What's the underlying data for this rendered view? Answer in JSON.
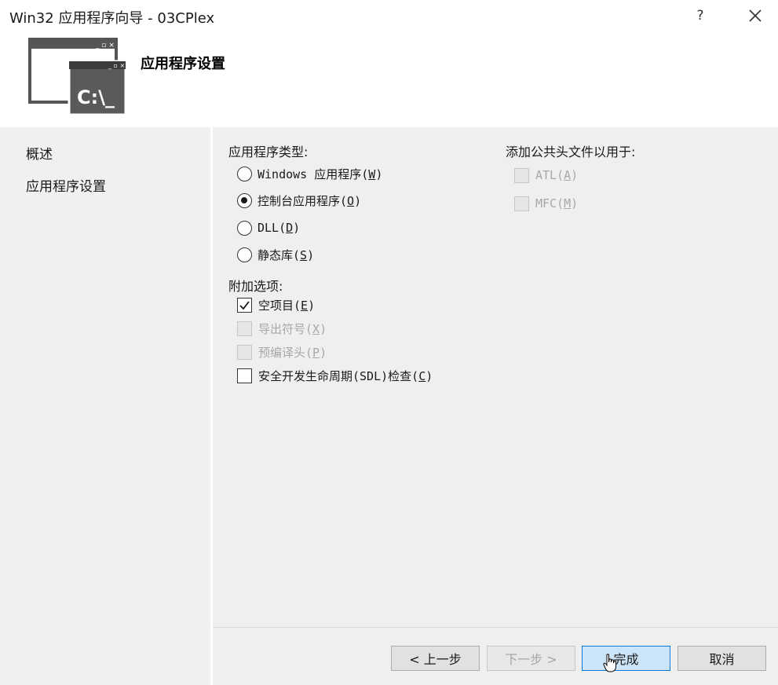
{
  "window": {
    "title": "Win32 应用程序向导 - 03CPlex",
    "help_label": "?"
  },
  "header": {
    "title": "应用程序设置",
    "icon": "console-window-icon",
    "icon_text": "C:\\_"
  },
  "nav": {
    "items": [
      {
        "label": "概述"
      },
      {
        "label": "应用程序设置"
      }
    ]
  },
  "app_type": {
    "label": "应用程序类型:",
    "options": [
      {
        "text": "Windows 应用程序",
        "mnemonic": "W",
        "selected": false
      },
      {
        "text": "控制台应用程序",
        "mnemonic": "O",
        "selected": true
      },
      {
        "text": "DLL",
        "mnemonic": "D",
        "selected": false
      },
      {
        "text": "静态库",
        "mnemonic": "S",
        "selected": false
      }
    ]
  },
  "additional": {
    "label": "附加选项:",
    "options": [
      {
        "text": "空项目",
        "mnemonic": "E",
        "checked": true,
        "enabled": true
      },
      {
        "text": "导出符号",
        "mnemonic": "X",
        "checked": false,
        "enabled": false
      },
      {
        "text": "预编译头",
        "mnemonic": "P",
        "checked": false,
        "enabled": false
      },
      {
        "text": "安全开发生命周期(SDL)检查",
        "mnemonic": "C",
        "checked": false,
        "enabled": true
      }
    ]
  },
  "headers": {
    "label": "添加公共头文件以用于:",
    "options": [
      {
        "text": "ATL",
        "mnemonic": "A",
        "checked": false,
        "enabled": false
      },
      {
        "text": "MFC",
        "mnemonic": "M",
        "checked": false,
        "enabled": false
      }
    ]
  },
  "buttons": {
    "prev": "< 上一步",
    "next": "下一步 >",
    "finish": "完成",
    "cancel": "取消"
  },
  "colors": {
    "primary_button_bg": "#cce4f7",
    "primary_button_border": "#0078d7",
    "pane_bg": "#efefef"
  }
}
